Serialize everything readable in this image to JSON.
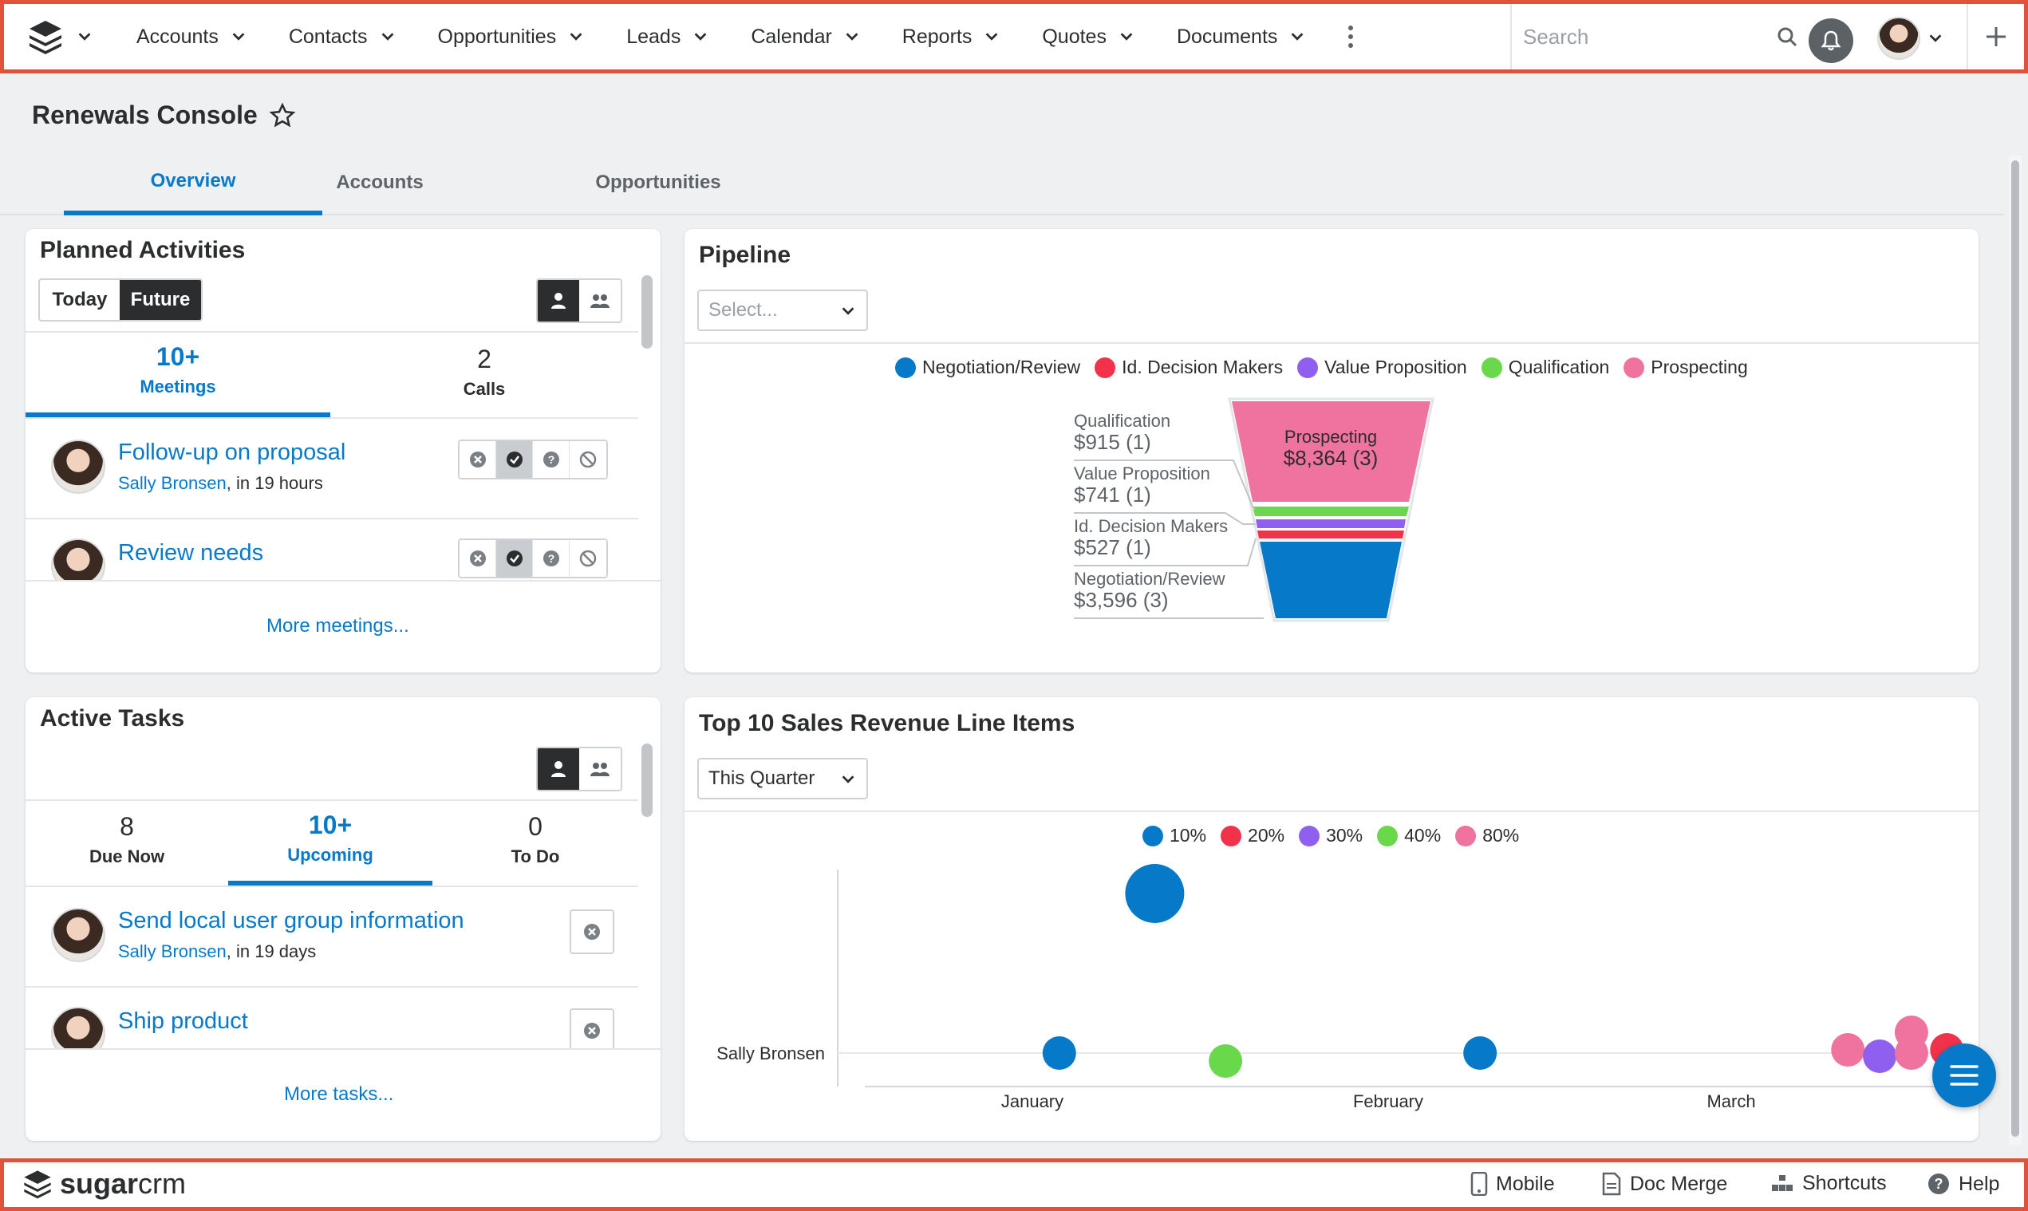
{
  "nav": {
    "items": [
      {
        "label": "Accounts"
      },
      {
        "label": "Contacts"
      },
      {
        "label": "Opportunities"
      },
      {
        "label": "Leads"
      },
      {
        "label": "Calendar"
      },
      {
        "label": "Reports"
      },
      {
        "label": "Quotes"
      },
      {
        "label": "Documents"
      }
    ],
    "search_placeholder": "Search"
  },
  "header": {
    "title": "Renewals Console",
    "tabs": [
      {
        "label": "Overview",
        "active": true
      },
      {
        "label": "Accounts"
      },
      {
        "label": "Opportunities"
      }
    ]
  },
  "planned_activities": {
    "title": "Planned Activities",
    "toggle": [
      "Today",
      "Future"
    ],
    "selected_toggle": "Future",
    "stats": [
      {
        "num": "10+",
        "label": "Meetings",
        "active": true
      },
      {
        "num": "2",
        "label": "Calls"
      }
    ],
    "rows": [
      {
        "title": "Follow-up on proposal",
        "user": "Sally Bronsen",
        "when": ", in 19 hours"
      },
      {
        "title": "Review needs"
      }
    ],
    "more": "More meetings..."
  },
  "active_tasks": {
    "title": "Active Tasks",
    "stats": [
      {
        "num": "8",
        "label": "Due Now"
      },
      {
        "num": "10+",
        "label": "Upcoming",
        "active": true
      },
      {
        "num": "0",
        "label": "To Do"
      }
    ],
    "rows": [
      {
        "title": "Send local user group information",
        "user": "Sally Bronsen",
        "when": ", in 19 days"
      },
      {
        "title": "Ship product"
      }
    ],
    "more": "More tasks..."
  },
  "pipeline": {
    "title": "Pipeline",
    "select_placeholder": "Select...",
    "legend": [
      {
        "name": "Negotiation/Review",
        "color": "#0679c8"
      },
      {
        "name": "Id. Decision Makers",
        "color": "#f2314b"
      },
      {
        "name": "Value Proposition",
        "color": "#8f5ff0"
      },
      {
        "name": "Qualification",
        "color": "#6ad84b"
      },
      {
        "name": "Prospecting",
        "color": "#f0729f"
      }
    ],
    "labels": [
      {
        "name": "Qualification",
        "value": "$915 (1)"
      },
      {
        "name": "Value Proposition",
        "value": "$741 (1)"
      },
      {
        "name": "Id. Decision Makers",
        "value": "$527 (1)"
      },
      {
        "name": "Negotiation/Review",
        "value": "$3,596 (3)"
      }
    ],
    "top_label": {
      "name": "Prospecting",
      "value": "$8,364 (3)"
    }
  },
  "chart_data": {
    "type": "scatter",
    "title": "Top 10 Sales Revenue Line Items",
    "period": "This Quarter",
    "categories_y": [
      "Sally Bronsen"
    ],
    "x_ticks": [
      "January",
      "February",
      "March"
    ],
    "legend": [
      {
        "name": "10%",
        "color": "#0679c8"
      },
      {
        "name": "20%",
        "color": "#f2314b"
      },
      {
        "name": "30%",
        "color": "#8f5ff0"
      },
      {
        "name": "40%",
        "color": "#6ad84b"
      },
      {
        "name": "80%",
        "color": "#f0729f"
      }
    ],
    "points": [
      {
        "series": "10%",
        "month": 0.82,
        "row_offset": 1.0,
        "size": 3
      },
      {
        "series": "10%",
        "month": 0.55,
        "row_offset": 0.0,
        "size": 1
      },
      {
        "series": "40%",
        "month": 1.02,
        "row_offset": -0.05,
        "size": 1
      },
      {
        "series": "10%",
        "month": 1.74,
        "row_offset": 0.0,
        "size": 1
      },
      {
        "series": "80%",
        "month": 2.78,
        "row_offset": 0.02,
        "size": 1
      },
      {
        "series": "30%",
        "month": 2.87,
        "row_offset": -0.02,
        "size": 1
      },
      {
        "series": "20%",
        "month": 3.06,
        "row_offset": 0.02,
        "size": 1
      },
      {
        "series": "80%",
        "month": 2.96,
        "row_offset": 0.13,
        "size": 1
      },
      {
        "series": "80%",
        "month": 2.96,
        "row_offset": 0.0,
        "size": 1
      }
    ]
  },
  "footer": {
    "brand_bold": "sugar",
    "brand_light": "crm",
    "items": [
      {
        "label": "Mobile"
      },
      {
        "label": "Doc Merge"
      },
      {
        "label": "Shortcuts"
      },
      {
        "label": "Help"
      }
    ]
  }
}
